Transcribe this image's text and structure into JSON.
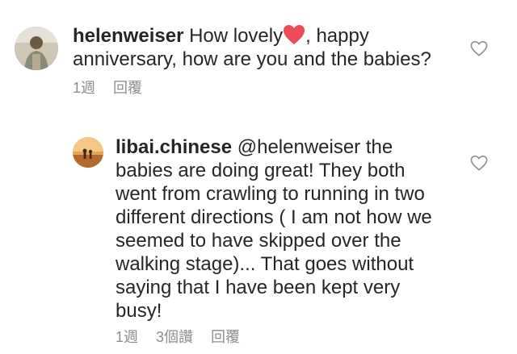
{
  "comments": [
    {
      "username": "helenweiser",
      "text_before_emoji": " How lovely",
      "emoji": "red-heart",
      "text_after_emoji": ", happy anniversary, how are you and the babies?",
      "meta": {
        "time": "1週",
        "reply": "回覆"
      }
    },
    {
      "username": "libai.chinese",
      "text": " @helenweiser the babies are doing great! They both went from crawling to running in two different directions ( I am not how we seemed to have skipped over the walking stage)... That goes without saying that I have been kept very busy!",
      "meta": {
        "time": "1週",
        "likes": "3個讚",
        "reply": "回覆"
      }
    }
  ],
  "colors": {
    "text": "#262626",
    "meta": "#8e8e8e",
    "heart": "#ed4956"
  }
}
